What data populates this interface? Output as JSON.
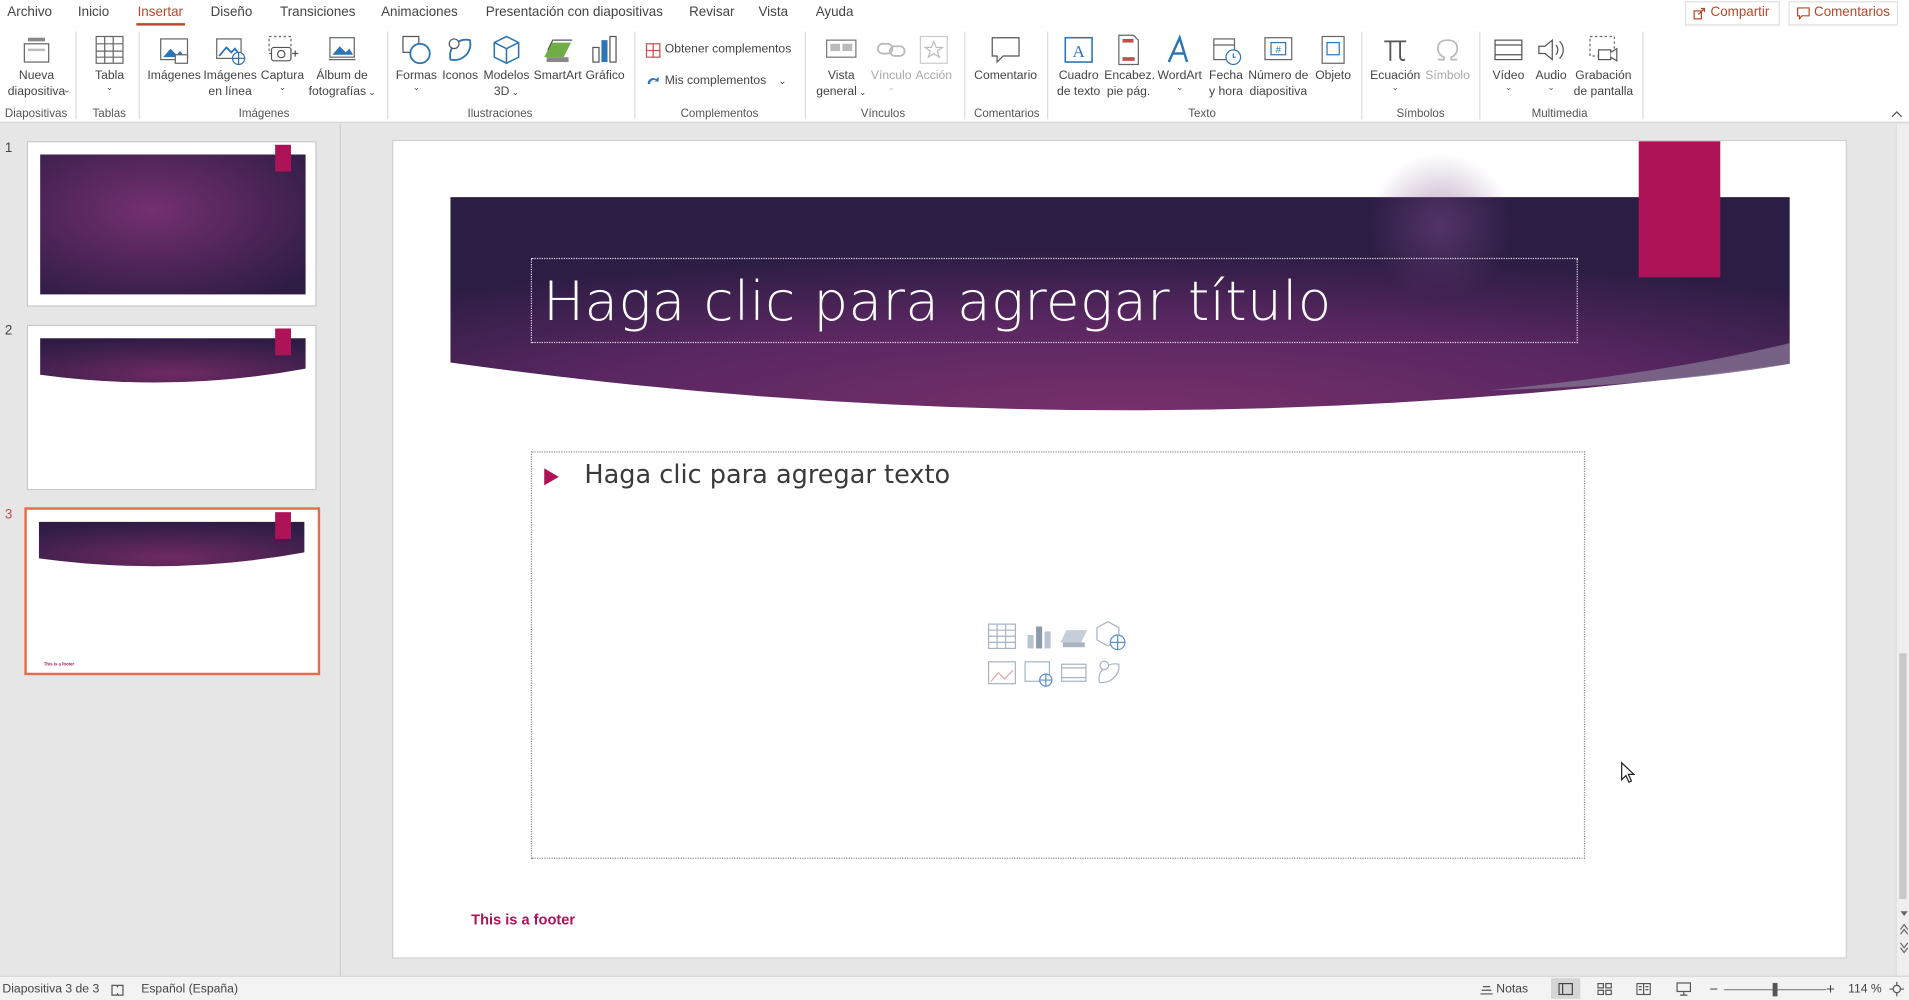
{
  "tabs": [
    "Archivo",
    "Inicio",
    "Insertar",
    "Diseño",
    "Transiciones",
    "Animaciones",
    "Presentación con diapositivas",
    "Revisar",
    "Vista",
    "Ayuda"
  ],
  "active_tab": "Insertar",
  "top_actions": {
    "share": "Compartir",
    "comments": "Comentarios"
  },
  "ribbon": {
    "new_slide": "Nueva diapositiva",
    "table": "Tabla",
    "images": "Imágenes",
    "online_images_1": "Imágenes",
    "online_images_2": "en línea",
    "capture": "Captura",
    "album_1": "Álbum de",
    "album_2": "fotografías",
    "shapes": "Formas",
    "icons": "Iconos",
    "models_1": "Modelos",
    "models_2": "3D",
    "smartart": "SmartArt",
    "chart": "Gráfico",
    "get_addins": "Obtener complementos",
    "my_addins": "Mis complementos",
    "overview_1": "Vista",
    "overview_2": "general",
    "link": "Vínculo",
    "action": "Acción",
    "comment": "Comentario",
    "textbox_1": "Cuadro",
    "textbox_2": "de texto",
    "header_1": "Encabez.",
    "header_2": "pie pág.",
    "wordart": "WordArt",
    "datetime_1": "Fecha",
    "datetime_2": "y hora",
    "slidenum_1": "Número de",
    "slidenum_2": "diapositiva",
    "object": "Objeto",
    "equation": "Ecuación",
    "symbol": "Símbolo",
    "video": "Vídeo",
    "audio": "Audio",
    "screenrec_1": "Grabación",
    "screenrec_2": "de pantalla",
    "groups": {
      "slides": "Diapositivas",
      "tables": "Tablas",
      "images": "Imágenes",
      "illustrations": "Ilustraciones",
      "addins": "Complementos",
      "links": "Vínculos",
      "comments": "Comentarios",
      "text": "Texto",
      "symbols": "Símbolos",
      "multimedia": "Multimedia"
    }
  },
  "thumbnails": [
    {
      "number": "1",
      "selected": false
    },
    {
      "number": "2",
      "selected": false
    },
    {
      "number": "3",
      "selected": true,
      "footer": "This is a footer"
    }
  ],
  "slide": {
    "title_placeholder": "Haga clic para agregar título",
    "body_placeholder": "Haga clic para agregar texto",
    "footer": "This is a footer",
    "accent_color": "#ad1457",
    "band_color": "#4a2355"
  },
  "statusbar": {
    "slide_info": "Diapositiva 3 de 3",
    "language": "Español (España)",
    "notes": "Notas",
    "zoom": "114 %"
  }
}
